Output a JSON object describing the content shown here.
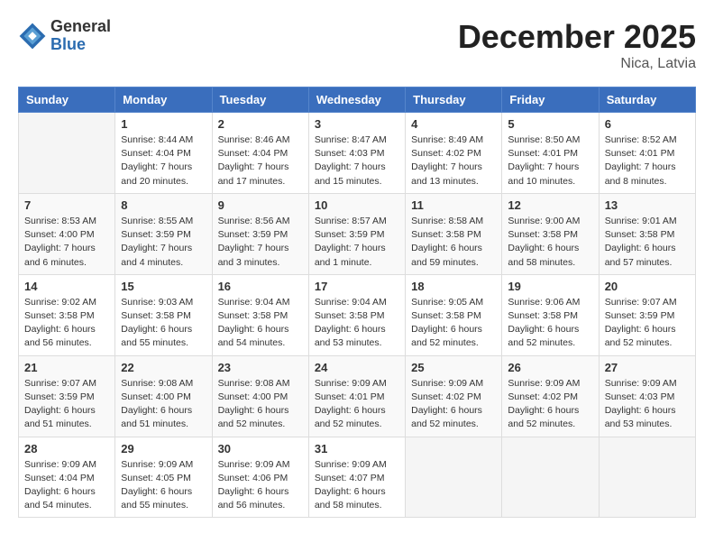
{
  "header": {
    "logo_general": "General",
    "logo_blue": "Blue",
    "month_title": "December 2025",
    "location": "Nica, Latvia"
  },
  "days_of_week": [
    "Sunday",
    "Monday",
    "Tuesday",
    "Wednesday",
    "Thursday",
    "Friday",
    "Saturday"
  ],
  "weeks": [
    [
      {
        "day": null,
        "info": null
      },
      {
        "day": "1",
        "info": "Sunrise: 8:44 AM\nSunset: 4:04 PM\nDaylight: 7 hours\nand 20 minutes."
      },
      {
        "day": "2",
        "info": "Sunrise: 8:46 AM\nSunset: 4:04 PM\nDaylight: 7 hours\nand 17 minutes."
      },
      {
        "day": "3",
        "info": "Sunrise: 8:47 AM\nSunset: 4:03 PM\nDaylight: 7 hours\nand 15 minutes."
      },
      {
        "day": "4",
        "info": "Sunrise: 8:49 AM\nSunset: 4:02 PM\nDaylight: 7 hours\nand 13 minutes."
      },
      {
        "day": "5",
        "info": "Sunrise: 8:50 AM\nSunset: 4:01 PM\nDaylight: 7 hours\nand 10 minutes."
      },
      {
        "day": "6",
        "info": "Sunrise: 8:52 AM\nSunset: 4:01 PM\nDaylight: 7 hours\nand 8 minutes."
      }
    ],
    [
      {
        "day": "7",
        "info": "Sunrise: 8:53 AM\nSunset: 4:00 PM\nDaylight: 7 hours\nand 6 minutes."
      },
      {
        "day": "8",
        "info": "Sunrise: 8:55 AM\nSunset: 3:59 PM\nDaylight: 7 hours\nand 4 minutes."
      },
      {
        "day": "9",
        "info": "Sunrise: 8:56 AM\nSunset: 3:59 PM\nDaylight: 7 hours\nand 3 minutes."
      },
      {
        "day": "10",
        "info": "Sunrise: 8:57 AM\nSunset: 3:59 PM\nDaylight: 7 hours\nand 1 minute."
      },
      {
        "day": "11",
        "info": "Sunrise: 8:58 AM\nSunset: 3:58 PM\nDaylight: 6 hours\nand 59 minutes."
      },
      {
        "day": "12",
        "info": "Sunrise: 9:00 AM\nSunset: 3:58 PM\nDaylight: 6 hours\nand 58 minutes."
      },
      {
        "day": "13",
        "info": "Sunrise: 9:01 AM\nSunset: 3:58 PM\nDaylight: 6 hours\nand 57 minutes."
      }
    ],
    [
      {
        "day": "14",
        "info": "Sunrise: 9:02 AM\nSunset: 3:58 PM\nDaylight: 6 hours\nand 56 minutes."
      },
      {
        "day": "15",
        "info": "Sunrise: 9:03 AM\nSunset: 3:58 PM\nDaylight: 6 hours\nand 55 minutes."
      },
      {
        "day": "16",
        "info": "Sunrise: 9:04 AM\nSunset: 3:58 PM\nDaylight: 6 hours\nand 54 minutes."
      },
      {
        "day": "17",
        "info": "Sunrise: 9:04 AM\nSunset: 3:58 PM\nDaylight: 6 hours\nand 53 minutes."
      },
      {
        "day": "18",
        "info": "Sunrise: 9:05 AM\nSunset: 3:58 PM\nDaylight: 6 hours\nand 52 minutes."
      },
      {
        "day": "19",
        "info": "Sunrise: 9:06 AM\nSunset: 3:58 PM\nDaylight: 6 hours\nand 52 minutes."
      },
      {
        "day": "20",
        "info": "Sunrise: 9:07 AM\nSunset: 3:59 PM\nDaylight: 6 hours\nand 52 minutes."
      }
    ],
    [
      {
        "day": "21",
        "info": "Sunrise: 9:07 AM\nSunset: 3:59 PM\nDaylight: 6 hours\nand 51 minutes."
      },
      {
        "day": "22",
        "info": "Sunrise: 9:08 AM\nSunset: 4:00 PM\nDaylight: 6 hours\nand 51 minutes."
      },
      {
        "day": "23",
        "info": "Sunrise: 9:08 AM\nSunset: 4:00 PM\nDaylight: 6 hours\nand 52 minutes."
      },
      {
        "day": "24",
        "info": "Sunrise: 9:09 AM\nSunset: 4:01 PM\nDaylight: 6 hours\nand 52 minutes."
      },
      {
        "day": "25",
        "info": "Sunrise: 9:09 AM\nSunset: 4:02 PM\nDaylight: 6 hours\nand 52 minutes."
      },
      {
        "day": "26",
        "info": "Sunrise: 9:09 AM\nSunset: 4:02 PM\nDaylight: 6 hours\nand 52 minutes."
      },
      {
        "day": "27",
        "info": "Sunrise: 9:09 AM\nSunset: 4:03 PM\nDaylight: 6 hours\nand 53 minutes."
      }
    ],
    [
      {
        "day": "28",
        "info": "Sunrise: 9:09 AM\nSunset: 4:04 PM\nDaylight: 6 hours\nand 54 minutes."
      },
      {
        "day": "29",
        "info": "Sunrise: 9:09 AM\nSunset: 4:05 PM\nDaylight: 6 hours\nand 55 minutes."
      },
      {
        "day": "30",
        "info": "Sunrise: 9:09 AM\nSunset: 4:06 PM\nDaylight: 6 hours\nand 56 minutes."
      },
      {
        "day": "31",
        "info": "Sunrise: 9:09 AM\nSunset: 4:07 PM\nDaylight: 6 hours\nand 58 minutes."
      },
      {
        "day": null,
        "info": null
      },
      {
        "day": null,
        "info": null
      },
      {
        "day": null,
        "info": null
      }
    ]
  ]
}
